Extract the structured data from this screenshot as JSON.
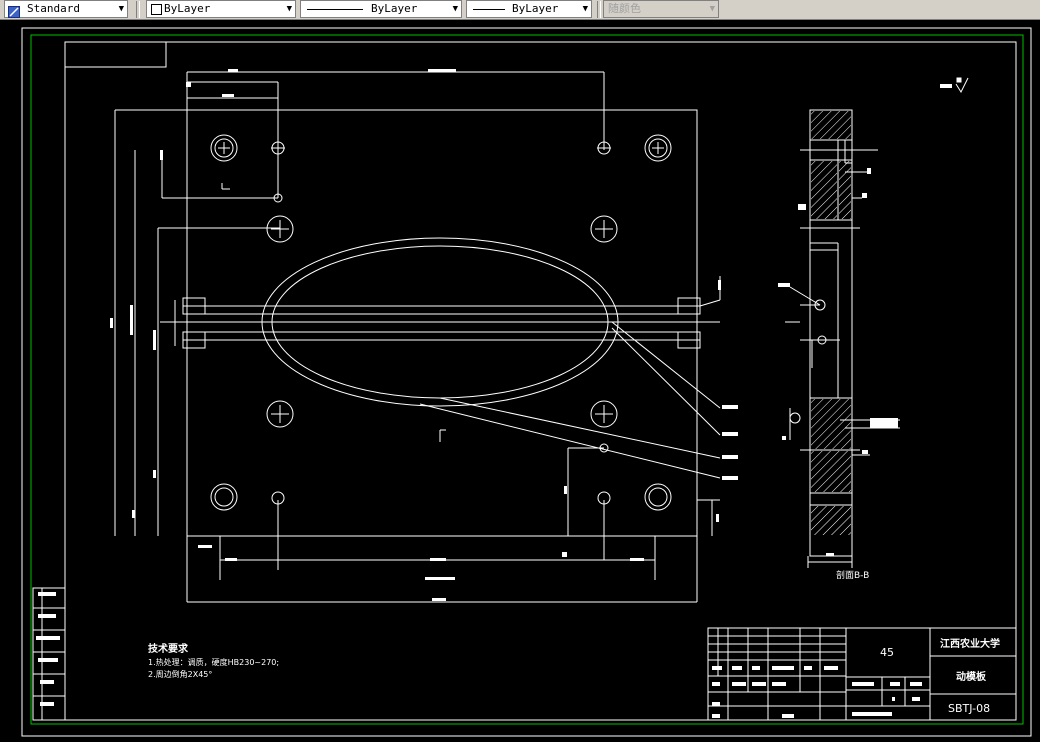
{
  "toolbar": {
    "text_style": "Standard",
    "layer": "ByLayer",
    "linetype": "ByLayer",
    "lineweight": "ByLayer",
    "plot_style": "随颜色"
  },
  "drawing": {
    "tech_title": "技术要求",
    "tech_line1": "1.热处理：调质，硬度HB230~270;",
    "tech_line2": "2.周边倒角2X45°",
    "section_label": "剖面B-B",
    "title_material": "45",
    "title_school": "江西农业大学",
    "title_part": "动模板",
    "title_code": "SBTJ-08"
  },
  "colors": {
    "background": "#000000",
    "lines": "#ffffff",
    "frame": "#00c000",
    "toolbar": "#d4d0c8"
  }
}
